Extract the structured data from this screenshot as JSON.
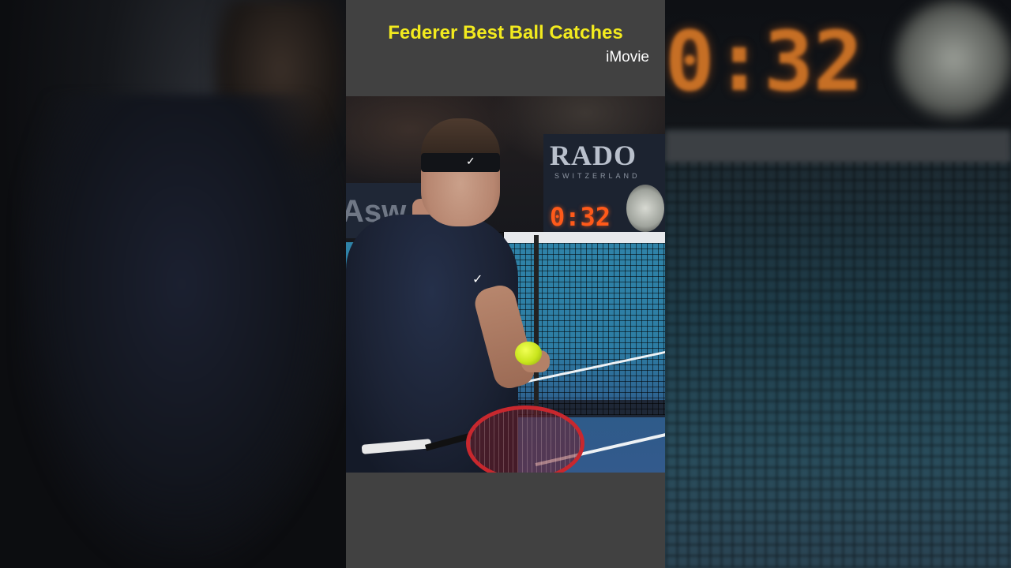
{
  "video": {
    "title": "Federer Best Ball Catches",
    "watermark": "iMovie"
  },
  "scene": {
    "sponsor_board": "RADO",
    "sponsor_sub": "SWITZERLAND",
    "clock": "0:32",
    "banner_fragment": "Asw"
  },
  "colors": {
    "title": "#f2ea1e",
    "clock": "#ff5a1a",
    "bars": "#414141"
  }
}
